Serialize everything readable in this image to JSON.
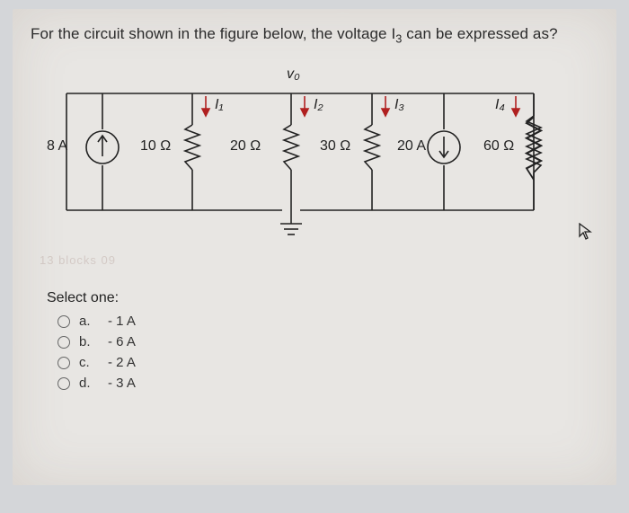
{
  "question": {
    "prefix": "For the circuit shown in the figure below, the voltage I",
    "sub": "3",
    "suffix": " can be expressed as?"
  },
  "figure": {
    "v0": "v₀",
    "i1": "I₁",
    "i2": "I₂",
    "i3": "I₃",
    "i4": "I₄",
    "src1": "8 A",
    "src2": "20 A",
    "r1": "10 Ω",
    "r2": "20 Ω",
    "r3": "30 Ω",
    "r4": "60 Ω"
  },
  "faint_text": "13 blocks  09",
  "select_label": "Select one:",
  "options": [
    {
      "letter": "a.",
      "text": "- 1 A"
    },
    {
      "letter": "b.",
      "text": "- 6 A"
    },
    {
      "letter": "c.",
      "text": "- 2 A"
    },
    {
      "letter": "d.",
      "text": "- 3 A"
    }
  ]
}
